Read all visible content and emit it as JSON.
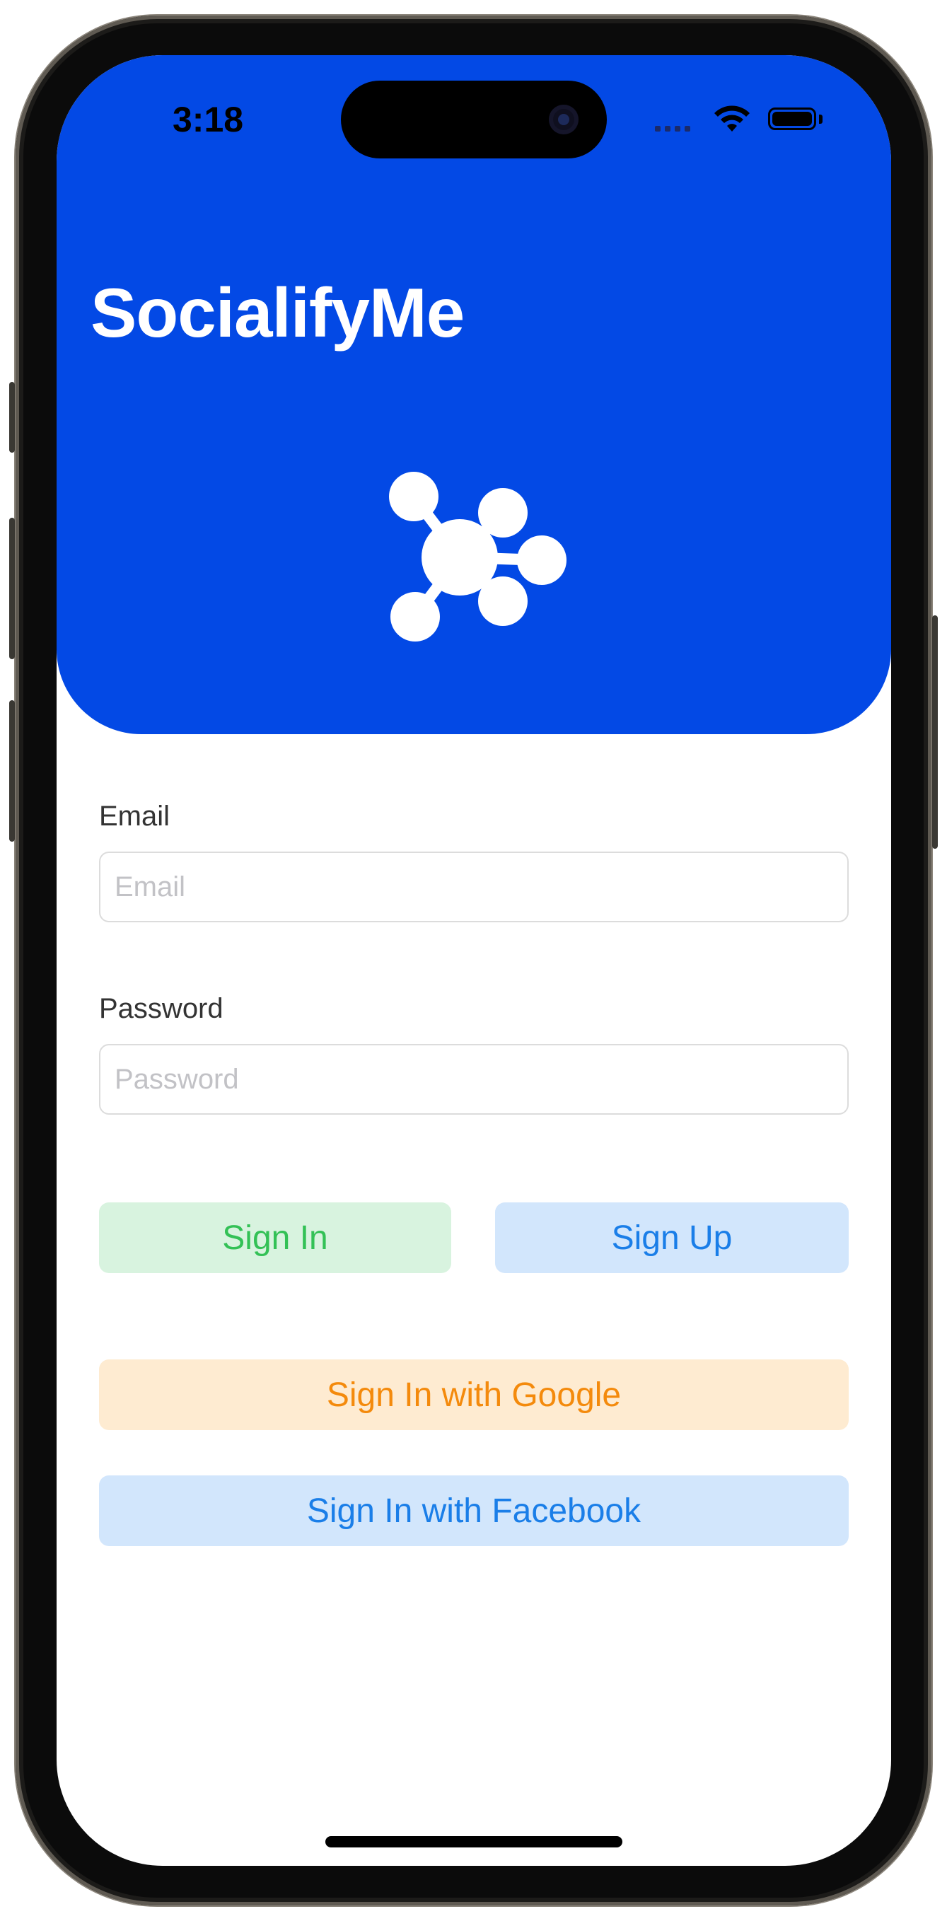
{
  "status_bar": {
    "time": "3:18",
    "icons": [
      "signal-icon",
      "wifi-icon",
      "battery-icon"
    ]
  },
  "header": {
    "app_title": "SocialifyMe",
    "logo_icon": "network-hub-icon",
    "background_color": "#0349e5"
  },
  "form": {
    "email": {
      "label": "Email",
      "placeholder": "Email",
      "value": ""
    },
    "password": {
      "label": "Password",
      "placeholder": "Password",
      "value": ""
    }
  },
  "buttons": {
    "sign_in": "Sign In",
    "sign_up": "Sign Up",
    "google": "Sign In with Google",
    "facebook": "Sign In with Facebook"
  },
  "colors": {
    "sign_in_text": "#33c156",
    "sign_up_text": "#1a7ee8",
    "google_text": "#f48a0c",
    "facebook_text": "#1a7ee8"
  }
}
